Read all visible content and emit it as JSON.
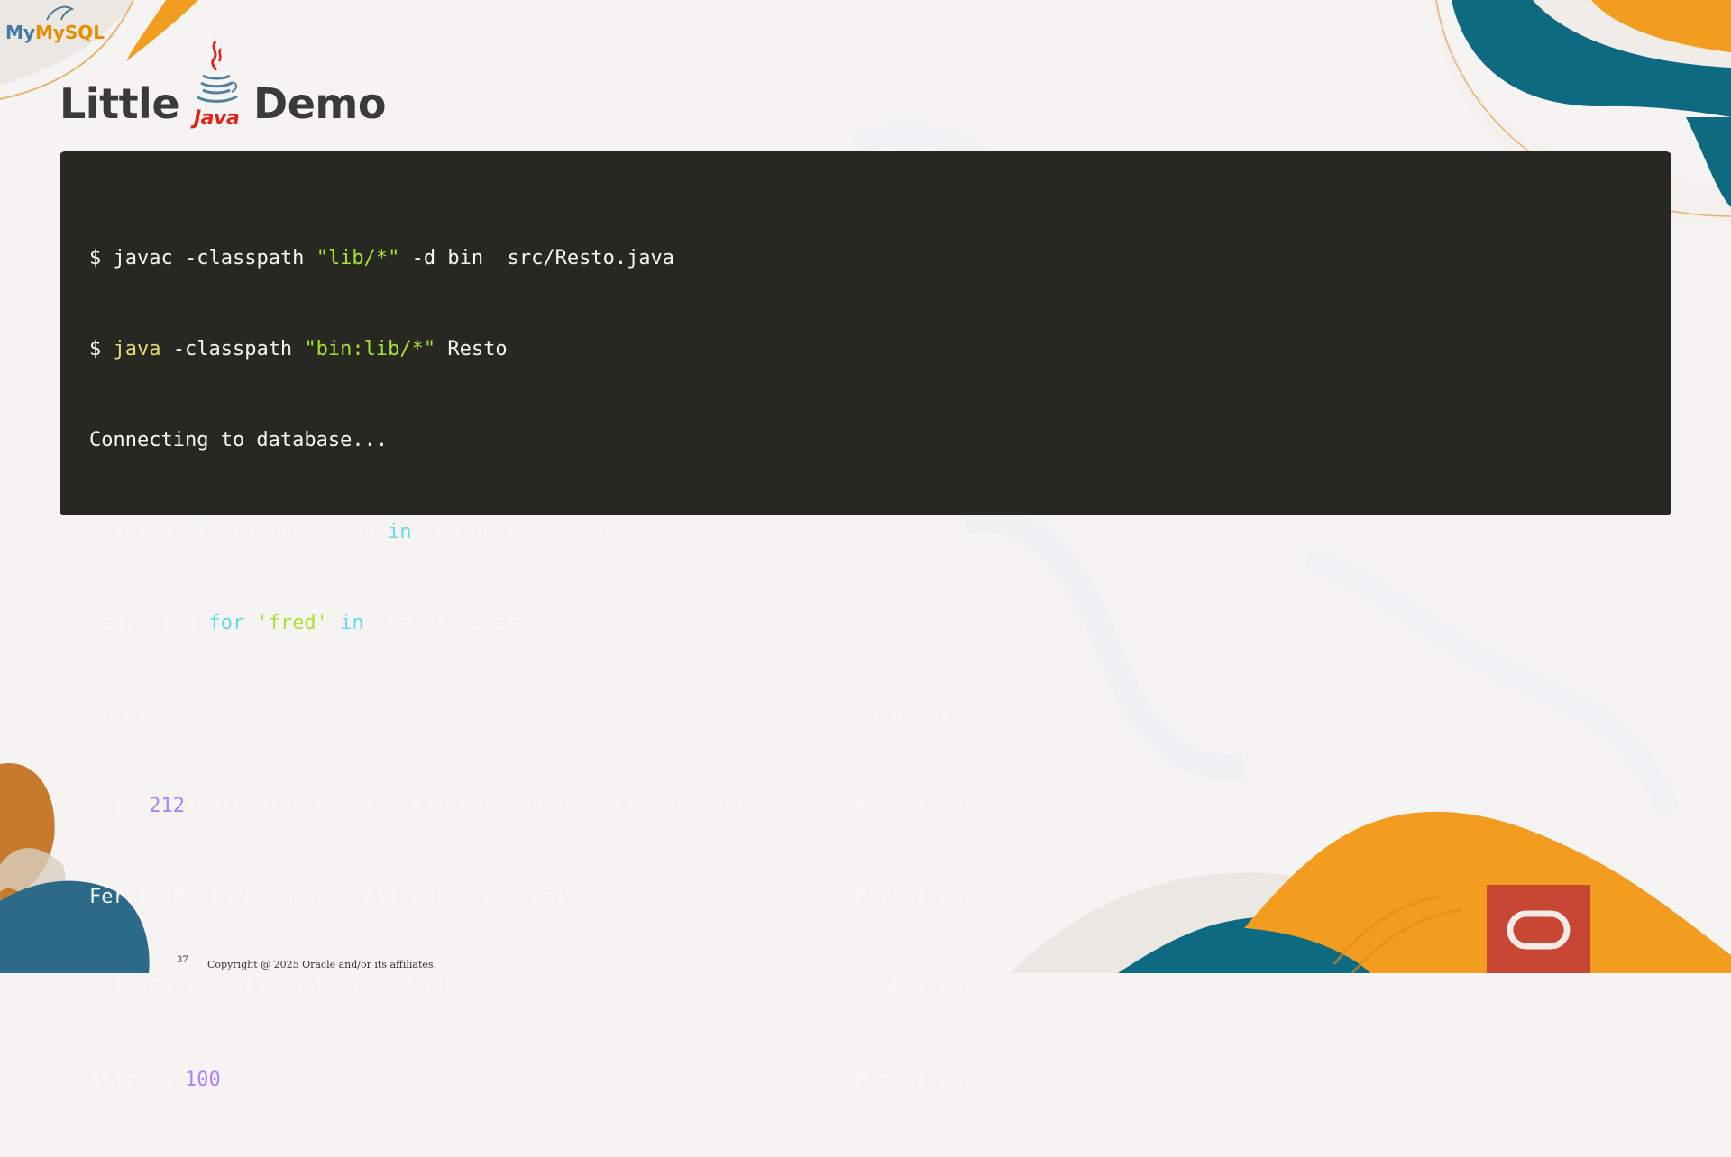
{
  "slide": {
    "title_before": "Little",
    "title_after": "Demo",
    "java_logo_text": "Java",
    "mysql_logo_text": "MySQL",
    "page_number": "37",
    "copyright": "Copyright @ 2025 Oracle and/or its affiliates."
  },
  "terminal": {
    "line1": {
      "prompt": "$ ",
      "cmd": "javac",
      "arg1": " -classpath ",
      "str": "\"lib/*\"",
      "rest": " -d bin  src/Resto.java"
    },
    "line2": {
      "prompt": "$ ",
      "cmd": "java",
      "arg1": " -classpath ",
      "str": "\"bin:lib/*\"",
      "rest": " Resto"
    },
    "line3": "Connecting to database...",
    "line4": {
      "a": "Enter a string to search ",
      "kw": "in",
      "b": " the database: fred"
    },
    "line5": {
      "a": "Searching ",
      "kw1": "for",
      "sp": " ",
      "str": "'fred'",
      "sp2": " ",
      "kw2": "in",
      "b": " the database..."
    },
    "header": {
      "name": "Name:",
      "borough": "| Borough:"
    },
    "rows": [
      {
        "a": "Cafe ",
        "num": "212",
        "b": "/Columbia Catering Kitchen - Alfred Lerner Hall",
        "borough": "| Manhattan"
      },
      {
        "a": "Ferris Booth Commons - Alfred Lerner Hall",
        "num": "",
        "b": "",
        "borough": "| Manhattan"
      },
      {
        "a": "Cafe East - Alfred Lerner Hall",
        "num": "",
        "b": "",
        "borough": "| Manhattan"
      },
      {
        "a": "Alfredo ",
        "num": "100",
        "b": "",
        "borough": "| Manhattan"
      }
    ]
  },
  "colors": {
    "background": "#f6f4f3",
    "terminal_bg": "#272822",
    "keyword": "#66d9ef",
    "string": "#a6e22e",
    "number": "#ae81ff",
    "command": "#e6db74",
    "accent_orange": "#f29d1f",
    "accent_teal": "#0e6a80",
    "oracle_red": "#c74634"
  }
}
